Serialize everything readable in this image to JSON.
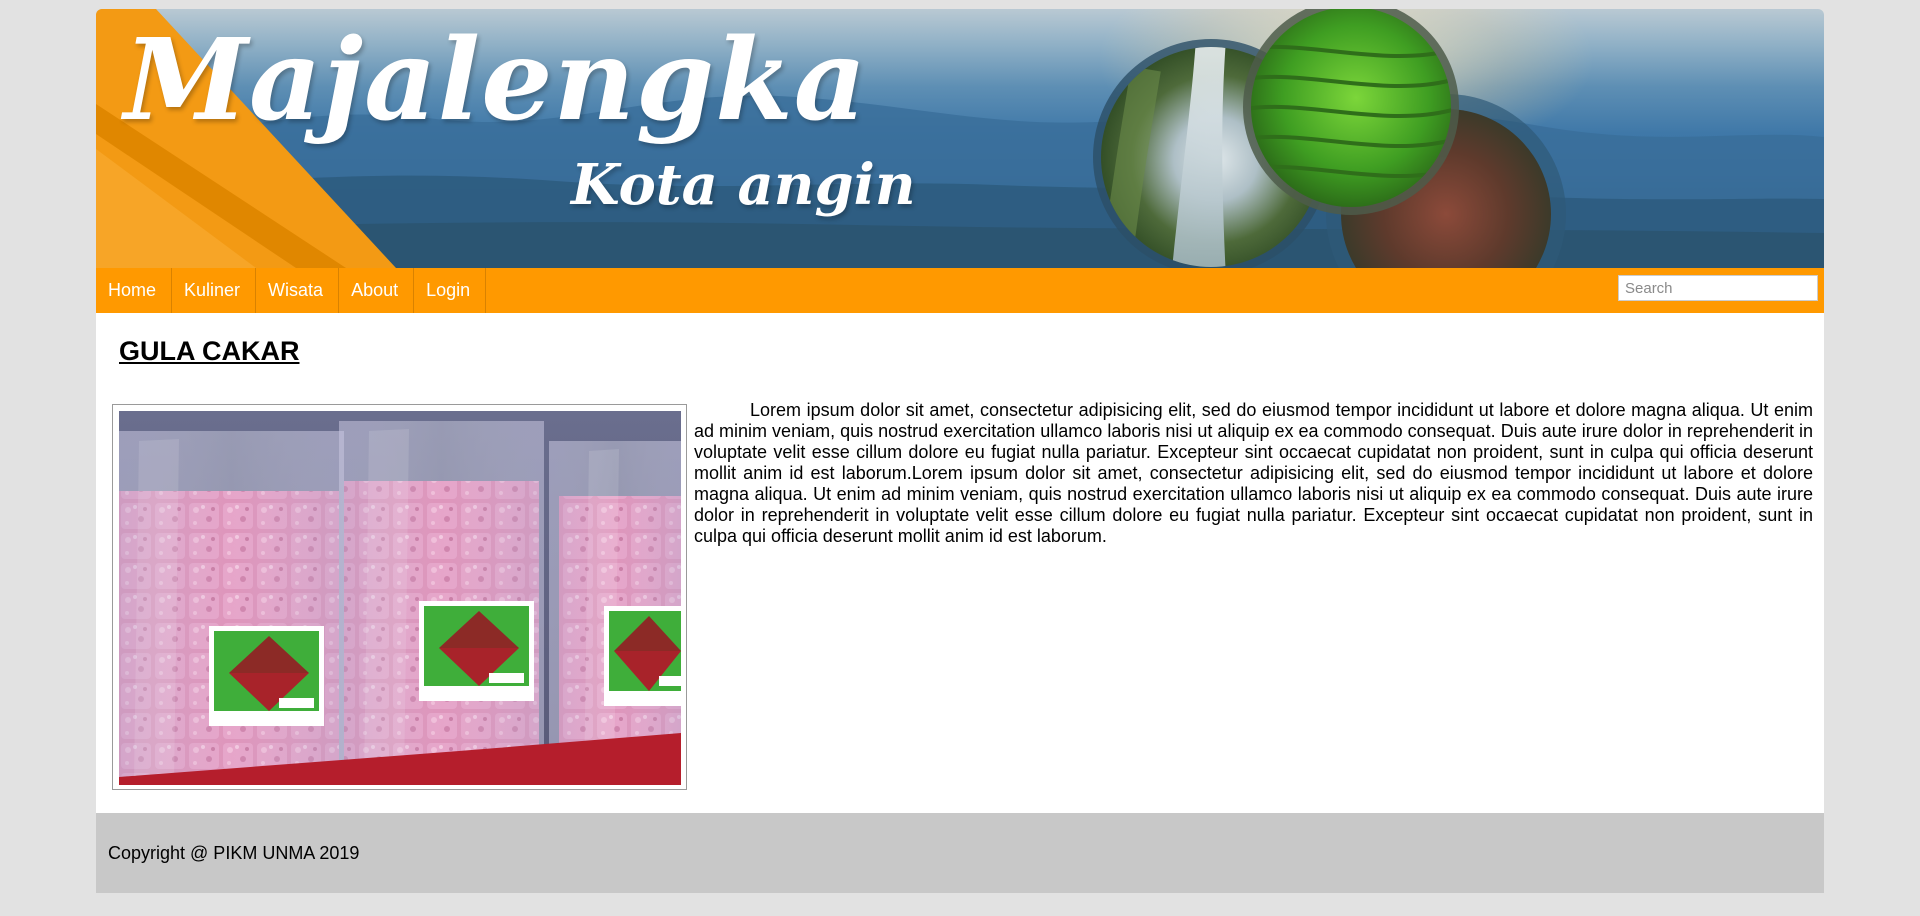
{
  "header": {
    "title": "Majalengka",
    "subtitle": "Kota angin"
  },
  "nav": {
    "items": [
      {
        "label": "Home"
      },
      {
        "label": "Kuliner"
      },
      {
        "label": "Wisata"
      },
      {
        "label": "About"
      },
      {
        "label": "Login"
      }
    ],
    "search": {
      "placeholder": "Search",
      "value": ""
    }
  },
  "main": {
    "heading": "GULA CAKAR",
    "image_alt": "Gula cakar product packages",
    "body": "Lorem ipsum dolor sit amet, consectetur adipisicing elit, sed do eiusmod tempor incididunt ut labore et dolore magna aliqua. Ut enim ad minim veniam, quis nostrud exercitation ullamco laboris nisi ut aliquip ex ea commodo consequat. Duis aute irure dolor in reprehenderit in voluptate velit esse cillum dolore eu fugiat nulla pariatur. Excepteur sint occaecat cupidatat non proident, sunt in culpa qui officia deserunt mollit anim id est laborum.Lorem ipsum dolor sit amet, consectetur adipisicing elit, sed do eiusmod tempor incididunt ut labore et dolore magna aliqua. Ut enim ad minim veniam, quis nostrud exercitation ullamco laboris nisi ut aliquip ex ea commodo consequat. Duis aute irure dolor in reprehenderit in voluptate velit esse cillum dolore eu fugiat nulla pariatur. Excepteur sint occaecat cupidatat non proident, sunt in culpa qui officia deserunt mollit anim id est laborum."
  },
  "footer": {
    "copyright": "Copyright @ PIKM UNMA 2019"
  },
  "colors": {
    "accent": "#ff9900",
    "background": "#e2e2e2",
    "footer": "#c8c8c8"
  }
}
